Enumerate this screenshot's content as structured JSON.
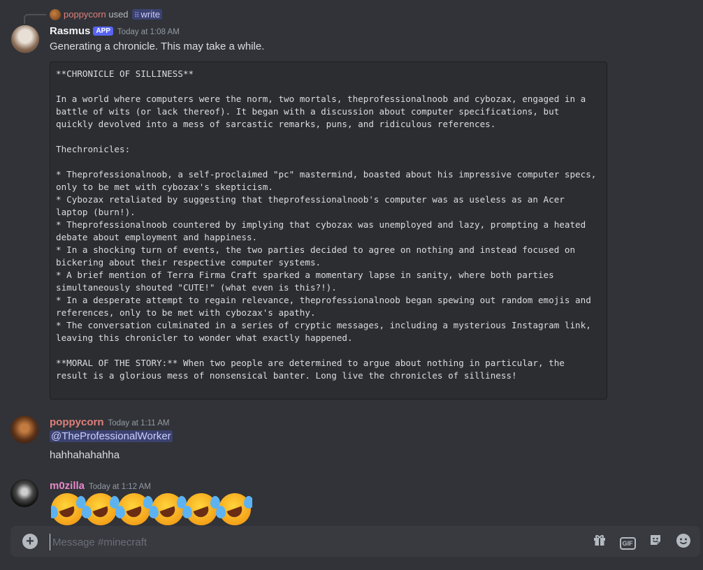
{
  "reply": {
    "user": "poppycorn",
    "verb": "used",
    "command": "write"
  },
  "messages": [
    {
      "author": "Rasmus",
      "author_color": "#f2f3f5",
      "badge": "APP",
      "timestamp": "Today at 1:08 AM",
      "text": "Generating a chronicle. This may take a while.",
      "code": "**CHRONICLE OF SILLINESS**\n\nIn a world where computers were the norm, two mortals, theprofessionalnoob and cybozax, engaged in a battle of wits (or lack thereof). It began with a discussion about computer specifications, but quickly devolved into a mess of sarcastic remarks, puns, and ridiculous references.\n\nThechronicles:\n\n* Theprofessionalnoob, a self-proclaimed \"pc\" mastermind, boasted about his impressive computer specs, only to be met with cybozax's skepticism.\n* Cybozax retaliated by suggesting that theprofessionalnoob's computer was as useless as an Acer laptop (burn!).\n* Theprofessionalnoob countered by implying that cybozax was unemployed and lazy, prompting a heated debate about employment and happiness.\n* In a shocking turn of events, the two parties decided to agree on nothing and instead focused on bickering about their respective computer systems.\n* A brief mention of Terra Firma Craft sparked a momentary lapse in sanity, where both parties simultaneously shouted \"CUTE!\" (what even is this?!).\n* In a desperate attempt to regain relevance, theprofessionalnoob began spewing out random emojis and references, only to be met with cybozax's apathy.\n* The conversation culminated in a series of cryptic messages, including a mysterious Instagram link, leaving this chronicler to wonder what exactly happened.\n\n**MORAL OF THE STORY:** When two people are determined to argue about nothing in particular, the result is a glorious mess of nonsensical banter. Long live the chronicles of silliness!"
    },
    {
      "author": "poppycorn",
      "author_color": "#e0807c",
      "timestamp": "Today at 1:11 AM",
      "mention": "@TheProfessionalWorker",
      "text": "hahhahahahha"
    },
    {
      "author": "m0zilla",
      "author_color": "#e889c8",
      "timestamp": "Today at 1:12 AM",
      "emoji_name": "rolling-on-the-floor-laughing",
      "emoji_count": 6
    }
  ],
  "composer": {
    "placeholder": "Message #minecraft",
    "gif_label": "GIF"
  }
}
